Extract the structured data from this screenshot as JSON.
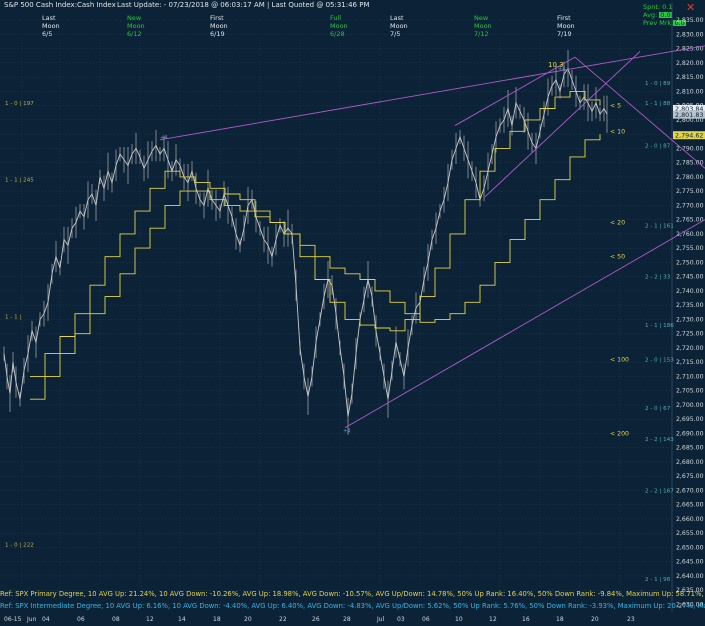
{
  "titlebar": {
    "instrument": "S&P 500 Cash Index:",
    "type": "Cash Index",
    "last_update": "Last Update:  - 07/23/2018 @ 06:03:17 AM | Last Quoted @ 05:31:46 PM"
  },
  "header_columns": [
    {
      "l1": "Last",
      "l2": "Moon",
      "l3": "6/5",
      "c1": "white",
      "c2": "white",
      "c3": "white"
    },
    {
      "l1": "New",
      "l2": "Moon",
      "l3": "6/12",
      "c1": "green",
      "c2": "green",
      "c3": "green"
    },
    {
      "l1": "First",
      "l2": "Moon",
      "l3": "6/19",
      "c1": "white",
      "c2": "white",
      "c3": "white"
    },
    {
      "l1": "Full",
      "l2": "Moon",
      "l3": "6/28",
      "c1": "green",
      "c2": "green",
      "c3": "green"
    },
    {
      "l1": "Last",
      "l2": "Moon",
      "l3": "7/5",
      "c1": "white",
      "c2": "white",
      "c3": "white"
    },
    {
      "l1": "New",
      "l2": "Moon",
      "l3": "7/12",
      "c1": "green",
      "c2": "green",
      "c3": "green"
    },
    {
      "l1": "First",
      "l2": "Moon",
      "l3": "7/19",
      "c1": "white",
      "c2": "white",
      "c3": "white"
    }
  ],
  "stats": {
    "spnt": "Spnt: 0.1",
    "avg": "Avg: ",
    "avg_box": "0.0",
    "prev": "Prev Mrk:",
    "prev_box": "0.0"
  },
  "chart_data": {
    "type": "line",
    "title": "S&P 500 Cash Index",
    "ylim": [
      2627,
      2841
    ],
    "yticks": [
      2630,
      2635,
      2640,
      2645,
      2650,
      2655,
      2660,
      2665,
      2670,
      2675,
      2680,
      2685,
      2690,
      2695,
      2700,
      2705,
      2710,
      2715,
      2720,
      2725,
      2730,
      2735,
      2740,
      2745,
      2750,
      2755,
      2760,
      2765,
      2770,
      2775,
      2780,
      2785,
      2790,
      2795,
      2800,
      2805,
      2810,
      2815,
      2820,
      2825,
      2830,
      2835
    ],
    "ytick_labels": [
      "2,630.00",
      "2,635.00",
      "2,640.00",
      "2,645.00",
      "2,650.00",
      "2,655.00",
      "2,660.00",
      "2,665.00",
      "2,670.00",
      "2,675.00",
      "2,680.00",
      "2,685.00",
      "2,690.00",
      "2,695.00",
      "2,700.00",
      "2,705.00",
      "2,710.00",
      "2,715.00",
      "2,720.00",
      "2,725.00",
      "2,730.00",
      "2,735.00",
      "2,740.00",
      "2,745.00",
      "2,750.00",
      "2,755.00",
      "2,760.00",
      "2,765.00",
      "2,770.00",
      "2,775.00",
      "2,780.00",
      "2,785.00",
      "2,790.00",
      "2,795.00",
      "2,800.00",
      "2,805.00",
      "2,810.00",
      "2,815.00",
      "2,820.00",
      "2,825.00",
      "2,830.00",
      "2,835.00"
    ],
    "price_label": "2,803.84",
    "price_label2": "2,801.83",
    "price_value": 2803.84,
    "price_value2": 2801.83,
    "ma_label": "2,794.62",
    "ma_value": 2794.62,
    "annotation": "10.3",
    "date_labels": [
      "06-15",
      "Jun",
      "04",
      "06",
      "08",
      "12",
      "14",
      "18",
      "20",
      "22",
      "26",
      "28",
      "Jul",
      "03",
      "06",
      "10",
      "12",
      "16",
      "18",
      "20",
      "23"
    ],
    "price_path": [
      [
        0,
        2718
      ],
      [
        3,
        2710
      ],
      [
        6,
        2704
      ],
      [
        9,
        2715
      ],
      [
        12,
        2708
      ],
      [
        16,
        2702
      ],
      [
        20,
        2712
      ],
      [
        24,
        2718
      ],
      [
        28,
        2726
      ],
      [
        32,
        2722
      ],
      [
        36,
        2730
      ],
      [
        40,
        2732
      ],
      [
        44,
        2736
      ],
      [
        48,
        2746
      ],
      [
        52,
        2752
      ],
      [
        56,
        2748
      ],
      [
        60,
        2758
      ],
      [
        64,
        2756
      ],
      [
        68,
        2762
      ],
      [
        72,
        2764
      ],
      [
        76,
        2768
      ],
      [
        80,
        2766
      ],
      [
        84,
        2772
      ],
      [
        88,
        2774
      ],
      [
        92,
        2770
      ],
      [
        96,
        2780
      ],
      [
        100,
        2776
      ],
      [
        104,
        2782
      ],
      [
        108,
        2778
      ],
      [
        112,
        2784
      ],
      [
        116,
        2788
      ],
      [
        120,
        2786
      ],
      [
        124,
        2784
      ],
      [
        128,
        2788
      ],
      [
        132,
        2790
      ],
      [
        136,
        2787
      ],
      [
        140,
        2783
      ],
      [
        144,
        2786
      ],
      [
        148,
        2789
      ],
      [
        152,
        2791
      ],
      [
        156,
        2788
      ],
      [
        160,
        2790
      ],
      [
        164,
        2786
      ],
      [
        168,
        2782
      ],
      [
        172,
        2786
      ],
      [
        176,
        2784
      ],
      [
        180,
        2780
      ],
      [
        184,
        2778
      ],
      [
        188,
        2782
      ],
      [
        192,
        2776
      ],
      [
        196,
        2772
      ],
      [
        200,
        2770
      ],
      [
        204,
        2776
      ],
      [
        208,
        2772
      ],
      [
        212,
        2770
      ],
      [
        216,
        2768
      ],
      [
        220,
        2774
      ],
      [
        224,
        2770
      ],
      [
        228,
        2766
      ],
      [
        232,
        2760
      ],
      [
        236,
        2756
      ],
      [
        240,
        2762
      ],
      [
        244,
        2770
      ],
      [
        248,
        2772
      ],
      [
        252,
        2766
      ],
      [
        256,
        2762
      ],
      [
        260,
        2758
      ],
      [
        264,
        2756
      ],
      [
        268,
        2752
      ],
      [
        272,
        2758
      ],
      [
        276,
        2763
      ],
      [
        280,
        2760
      ],
      [
        284,
        2762
      ],
      [
        288,
        2760
      ],
      [
        292,
        2742
      ],
      [
        296,
        2720
      ],
      [
        300,
        2710
      ],
      [
        304,
        2703
      ],
      [
        308,
        2710
      ],
      [
        312,
        2722
      ],
      [
        316,
        2730
      ],
      [
        320,
        2738
      ],
      [
        324,
        2744
      ],
      [
        328,
        2742
      ],
      [
        332,
        2732
      ],
      [
        336,
        2720
      ],
      [
        340,
        2710
      ],
      [
        344,
        2696
      ],
      [
        348,
        2704
      ],
      [
        352,
        2718
      ],
      [
        356,
        2730
      ],
      [
        360,
        2737
      ],
      [
        364,
        2744
      ],
      [
        368,
        2738
      ],
      [
        372,
        2726
      ],
      [
        376,
        2718
      ],
      [
        380,
        2710
      ],
      [
        384,
        2702
      ],
      [
        388,
        2712
      ],
      [
        392,
        2722
      ],
      [
        396,
        2716
      ],
      [
        400,
        2710
      ],
      [
        404,
        2720
      ],
      [
        408,
        2728
      ],
      [
        412,
        2734
      ],
      [
        416,
        2736
      ],
      [
        420,
        2744
      ],
      [
        424,
        2750
      ],
      [
        428,
        2758
      ],
      [
        432,
        2762
      ],
      [
        436,
        2768
      ],
      [
        440,
        2772
      ],
      [
        444,
        2778
      ],
      [
        448,
        2786
      ],
      [
        452,
        2790
      ],
      [
        456,
        2794
      ],
      [
        460,
        2790
      ],
      [
        464,
        2786
      ],
      [
        468,
        2782
      ],
      [
        472,
        2778
      ],
      [
        476,
        2772
      ],
      [
        480,
        2776
      ],
      [
        484,
        2782
      ],
      [
        488,
        2788
      ],
      [
        492,
        2794
      ],
      [
        496,
        2798
      ],
      [
        500,
        2800
      ],
      [
        504,
        2804
      ],
      [
        508,
        2798
      ],
      [
        512,
        2806
      ],
      [
        516,
        2803
      ],
      [
        520,
        2800
      ],
      [
        524,
        2796
      ],
      [
        528,
        2792
      ],
      [
        532,
        2790
      ],
      [
        536,
        2796
      ],
      [
        540,
        2802
      ],
      [
        544,
        2808
      ],
      [
        548,
        2812
      ],
      [
        552,
        2814
      ],
      [
        556,
        2810
      ],
      [
        560,
        2816
      ],
      [
        564,
        2818
      ],
      [
        568,
        2814
      ],
      [
        572,
        2810
      ],
      [
        576,
        2806
      ],
      [
        580,
        2808
      ],
      [
        584,
        2806
      ],
      [
        588,
        2803
      ],
      [
        592,
        2806
      ],
      [
        596,
        2802
      ],
      [
        600,
        2804
      ],
      [
        603,
        2802
      ]
    ],
    "ma_steps": [
      {
        "name": "ma_slow",
        "points": [
          [
            30,
            2702
          ],
          [
            45,
            2710
          ],
          [
            60,
            2718
          ],
          [
            75,
            2725
          ],
          [
            90,
            2732
          ],
          [
            105,
            2738
          ],
          [
            120,
            2746
          ],
          [
            135,
            2755
          ],
          [
            150,
            2762
          ],
          [
            165,
            2770
          ],
          [
            180,
            2775
          ],
          [
            195,
            2775
          ],
          [
            210,
            2772
          ],
          [
            225,
            2770
          ],
          [
            240,
            2768
          ],
          [
            255,
            2766
          ],
          [
            270,
            2764
          ],
          [
            285,
            2760
          ],
          [
            300,
            2756
          ],
          [
            315,
            2752
          ],
          [
            330,
            2748
          ],
          [
            345,
            2746
          ],
          [
            360,
            2744
          ],
          [
            375,
            2740
          ],
          [
            390,
            2736
          ],
          [
            405,
            2732
          ],
          [
            420,
            2729
          ],
          [
            435,
            2730
          ],
          [
            450,
            2732
          ],
          [
            465,
            2736
          ],
          [
            480,
            2742
          ],
          [
            495,
            2750
          ],
          [
            510,
            2758
          ],
          [
            525,
            2765
          ],
          [
            540,
            2772
          ],
          [
            555,
            2779
          ],
          [
            570,
            2787
          ],
          [
            585,
            2793
          ],
          [
            600,
            2795
          ]
        ]
      },
      {
        "name": "ma_fast",
        "points": [
          [
            30,
            2710
          ],
          [
            45,
            2718
          ],
          [
            60,
            2724
          ],
          [
            75,
            2732
          ],
          [
            90,
            2742
          ],
          [
            105,
            2752
          ],
          [
            120,
            2760
          ],
          [
            135,
            2768
          ],
          [
            150,
            2776
          ],
          [
            165,
            2782
          ],
          [
            180,
            2780
          ],
          [
            195,
            2778
          ],
          [
            210,
            2776
          ],
          [
            225,
            2774
          ],
          [
            240,
            2772
          ],
          [
            255,
            2768
          ],
          [
            270,
            2764
          ],
          [
            285,
            2760
          ],
          [
            300,
            2752
          ],
          [
            315,
            2744
          ],
          [
            330,
            2736
          ],
          [
            345,
            2730
          ],
          [
            360,
            2728
          ],
          [
            375,
            2727
          ],
          [
            390,
            2726
          ],
          [
            405,
            2730
          ],
          [
            420,
            2738
          ],
          [
            435,
            2748
          ],
          [
            450,
            2760
          ],
          [
            465,
            2772
          ],
          [
            480,
            2782
          ],
          [
            495,
            2790
          ],
          [
            510,
            2796
          ],
          [
            525,
            2800
          ],
          [
            540,
            2804
          ],
          [
            555,
            2808
          ],
          [
            570,
            2810
          ],
          [
            585,
            2807
          ],
          [
            600,
            2805
          ]
        ]
      }
    ],
    "channel_lines": [
      {
        "from": [
          160,
          2793
        ],
        "to": [
          705,
          2826
        ]
      },
      {
        "from": [
          345,
          2692
        ],
        "to": [
          705,
          2765
        ]
      },
      {
        "from": [
          455,
          2798
        ],
        "to": [
          575,
          2822
        ]
      },
      {
        "from": [
          485,
          2773
        ],
        "to": [
          640,
          2824
        ]
      },
      {
        "from": [
          575,
          2822
        ],
        "to": [
          705,
          2783
        ]
      }
    ],
    "level_labels": [
      {
        "x": 610,
        "v": 2805,
        "text": "< 5"
      },
      {
        "x": 610,
        "v": 2796,
        "text": "< 10"
      },
      {
        "x": 610,
        "v": 2764,
        "text": "< 20"
      },
      {
        "x": 610,
        "v": 2752,
        "text": "< 50"
      },
      {
        "x": 610,
        "v": 2716,
        "text": "< 100"
      },
      {
        "x": 610,
        "v": 2690,
        "text": "< 200"
      }
    ],
    "fib_labels": [
      {
        "x": 5,
        "v": 2806,
        "text": "1 - 0 | 197",
        "c": "y"
      },
      {
        "x": 5,
        "v": 2779,
        "text": "1 - 1 | 245",
        "c": "y"
      },
      {
        "x": 5,
        "v": 2731,
        "text": "1 - 1 |",
        "c": "y"
      },
      {
        "x": 5,
        "v": 2651,
        "text": "1 - 0 | 222",
        "c": "y"
      },
      {
        "x": 645,
        "v": 2813,
        "text": "1 - 0 | 89",
        "c": "c"
      },
      {
        "x": 645,
        "v": 2806,
        "text": "1 - 1 | 88",
        "c": "c"
      },
      {
        "x": 645,
        "v": 2791,
        "text": "2 - 0 | 87",
        "c": "c"
      },
      {
        "x": 645,
        "v": 2763,
        "text": "2 - 1 | 161",
        "c": "c"
      },
      {
        "x": 645,
        "v": 2745,
        "text": "2 - 2 | 33",
        "c": "c"
      },
      {
        "x": 645,
        "v": 2728,
        "text": "1 - 1 | 186",
        "c": "c"
      },
      {
        "x": 645,
        "v": 2716,
        "text": "2 - 0 | 153",
        "c": "c"
      },
      {
        "x": 645,
        "v": 2699,
        "text": "2 - 0 | 67",
        "c": "c"
      },
      {
        "x": 645,
        "v": 2688,
        "text": "2 - 2 | 143",
        "c": "c"
      },
      {
        "x": 645,
        "v": 2670,
        "text": "2 - 2 | 167",
        "c": "c"
      },
      {
        "x": 645,
        "v": 2639,
        "text": "2 - 1 | 98",
        "c": "c"
      }
    ],
    "markers": [
      {
        "x": 160,
        "v": 2794,
        "text": "+4"
      },
      {
        "x": 343,
        "v": 2691,
        "text": "+4"
      },
      {
        "x": 558,
        "v": 2818,
        "text": "+4"
      }
    ]
  },
  "footer": {
    "line1": "Ref: SPX Primary Degree, 10 AVG Up: 21.24%, 10 AVG Down: -10.26%, AVG Up: 18.98%, AVG Down: -10.57%, AVG Up/Down: 14.78%, 50%  Up Rank: 16.40%, 50% Down Rank: -9.84%, Maximum Up: 58.71%, Maximum",
    "line2": "Ref: SPX Intermediate Degree, 10 AVG Up: 6.16%, 10 AVG Down: -4.40%, AVG Up: 6.40%, AVG Down: -4.83%, AVG Up/Down: 5.62%, 50%  Up Rank: 5.76%, 50% Down Rank: -3.93%, Maximum Up: 20.27%, Maximum Dc"
  },
  "colors": {
    "bg": "#0c2236",
    "price": "#c8c8c8",
    "ma": "#e3d64a",
    "channel": "#b05cc8",
    "grid": "#27485f"
  }
}
